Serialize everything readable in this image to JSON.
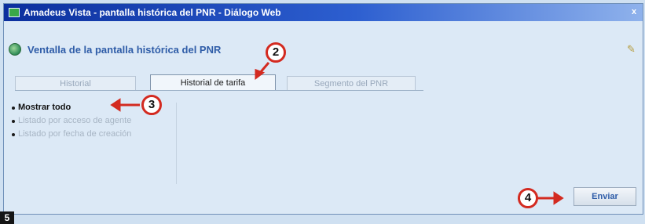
{
  "window": {
    "title": "Amadeus Vista - pantalla histórica del PNR - Diálogo Web",
    "close_glyph": "x"
  },
  "header": {
    "title": "Ventalla de la pantalla histórica del PNR",
    "icon": "globe-icon",
    "right_icon": "pen-icon"
  },
  "tabs": [
    {
      "label": "Historial",
      "active": false
    },
    {
      "label": "Historial de tarifa",
      "active": true
    },
    {
      "label": "Segmento del PNR",
      "active": false
    }
  ],
  "left_list": {
    "items": [
      {
        "label": "Mostrar todo"
      },
      {
        "label": "Listado por acceso de agente"
      },
      {
        "label": "Listado por fecha de creación"
      }
    ]
  },
  "actions": {
    "send_label": "Enviar"
  },
  "callouts": {
    "c2": "2",
    "c3": "3",
    "c4": "4"
  },
  "step_badge": "5",
  "colors": {
    "titlebar_start": "#0b2f9e",
    "header_text": "#2f5da8",
    "callout_red": "#d32a20"
  }
}
